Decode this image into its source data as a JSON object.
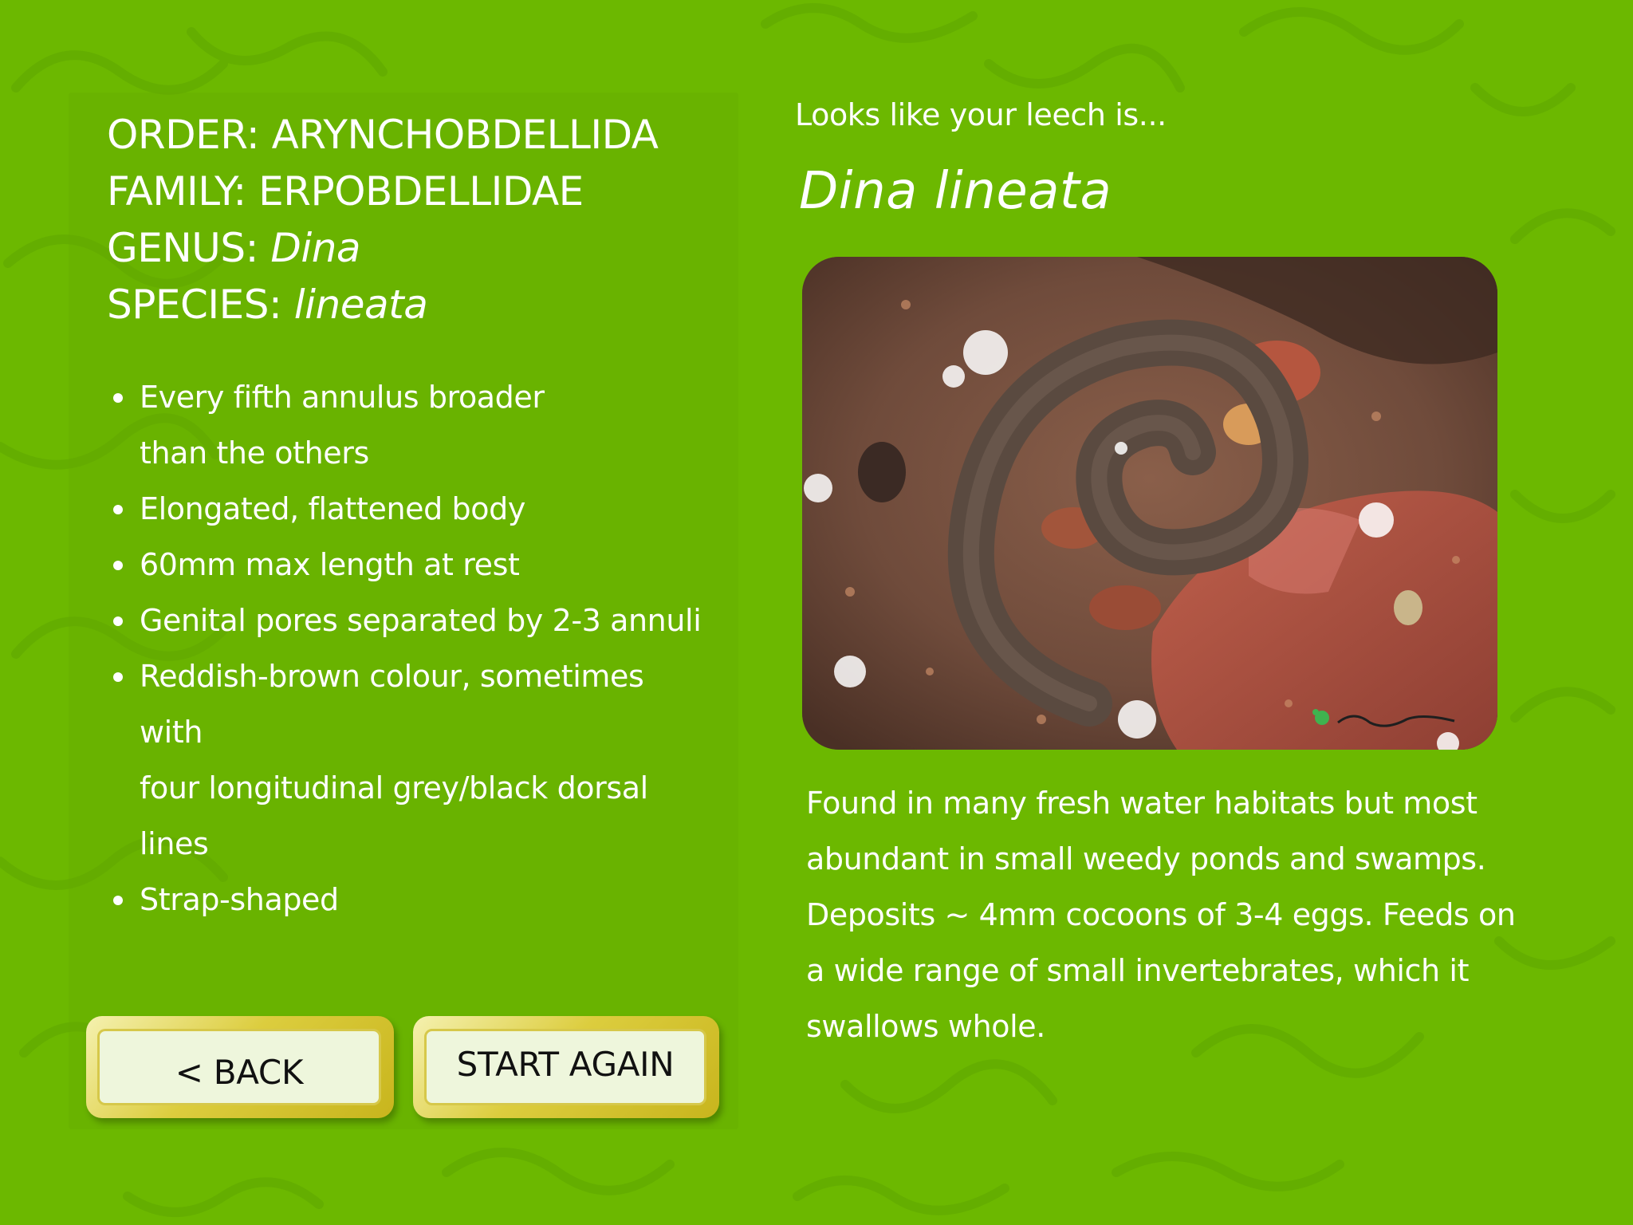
{
  "taxonomy": {
    "order_label": "ORDER:",
    "order_value": "ARYNCHOBDELLIDA",
    "family_label": "FAMILY:",
    "family_value": "ERPOBDELLIDAE",
    "genus_label": "GENUS:",
    "genus_value": "Dina",
    "species_label": "SPECIES:",
    "species_value": "lineata"
  },
  "features": [
    "Every fifth annulus broader",
    "than the others",
    "Elongated, flattened body",
    "60mm max length at rest",
    "Genital pores separated by 2-3 annuli",
    "Reddish-brown colour, sometimes with",
    "four longitudinal grey/black dorsal lines",
    "Strap-shaped"
  ],
  "buttons": {
    "back": "< BACK",
    "start_again": "START AGAIN"
  },
  "result": {
    "intro": "Looks like your leech is...",
    "species_name": "Dina lineata",
    "description": "Found in many fresh water habitats but most abundant in small weedy ponds and swamps. Deposits ~ 4mm cocoons of 3-4 eggs. Feeds on a wide range of small invertebrates, which it swallows whole."
  },
  "colors": {
    "background": "#6cb800",
    "button_face": "#eef6dc",
    "button_border": "#d6c84a",
    "text": "#ffffff",
    "button_text": "#111111"
  },
  "icons": {
    "background_pattern": "faint leech silhouette pattern",
    "photo_watermark": "frog-logo"
  }
}
